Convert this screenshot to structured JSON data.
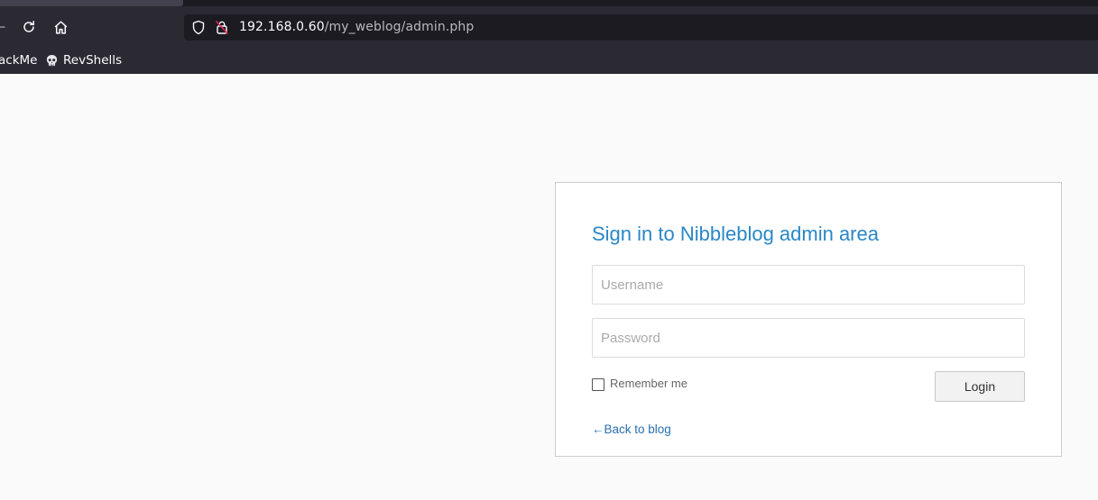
{
  "browser": {
    "url_host": "192.168.0.60",
    "url_path": "/my_weblog/admin.php",
    "bookmarks": [
      {
        "label": "ackMe",
        "icon": "bookmark-icon"
      },
      {
        "label": "RevShells",
        "icon": "skull-icon"
      }
    ],
    "icons": {
      "back": "arrow-left-icon",
      "reload": "reload-icon",
      "home": "home-icon",
      "shield": "shield-icon",
      "lock": "insecure-lock-icon"
    }
  },
  "login": {
    "title": "Sign in to Nibbleblog admin area",
    "username_placeholder": "Username",
    "password_placeholder": "Password",
    "remember_label": "Remember me",
    "remember_checked": false,
    "login_button": "Login",
    "back_link": "←Back to blog"
  },
  "colors": {
    "chrome_bg": "#2b2a33",
    "urlbar_bg": "#1c1b22",
    "page_bg": "#fafafa",
    "title_blue": "#2a87c7",
    "link_blue": "#2a6fb0",
    "insecure_red": "#e22850"
  }
}
